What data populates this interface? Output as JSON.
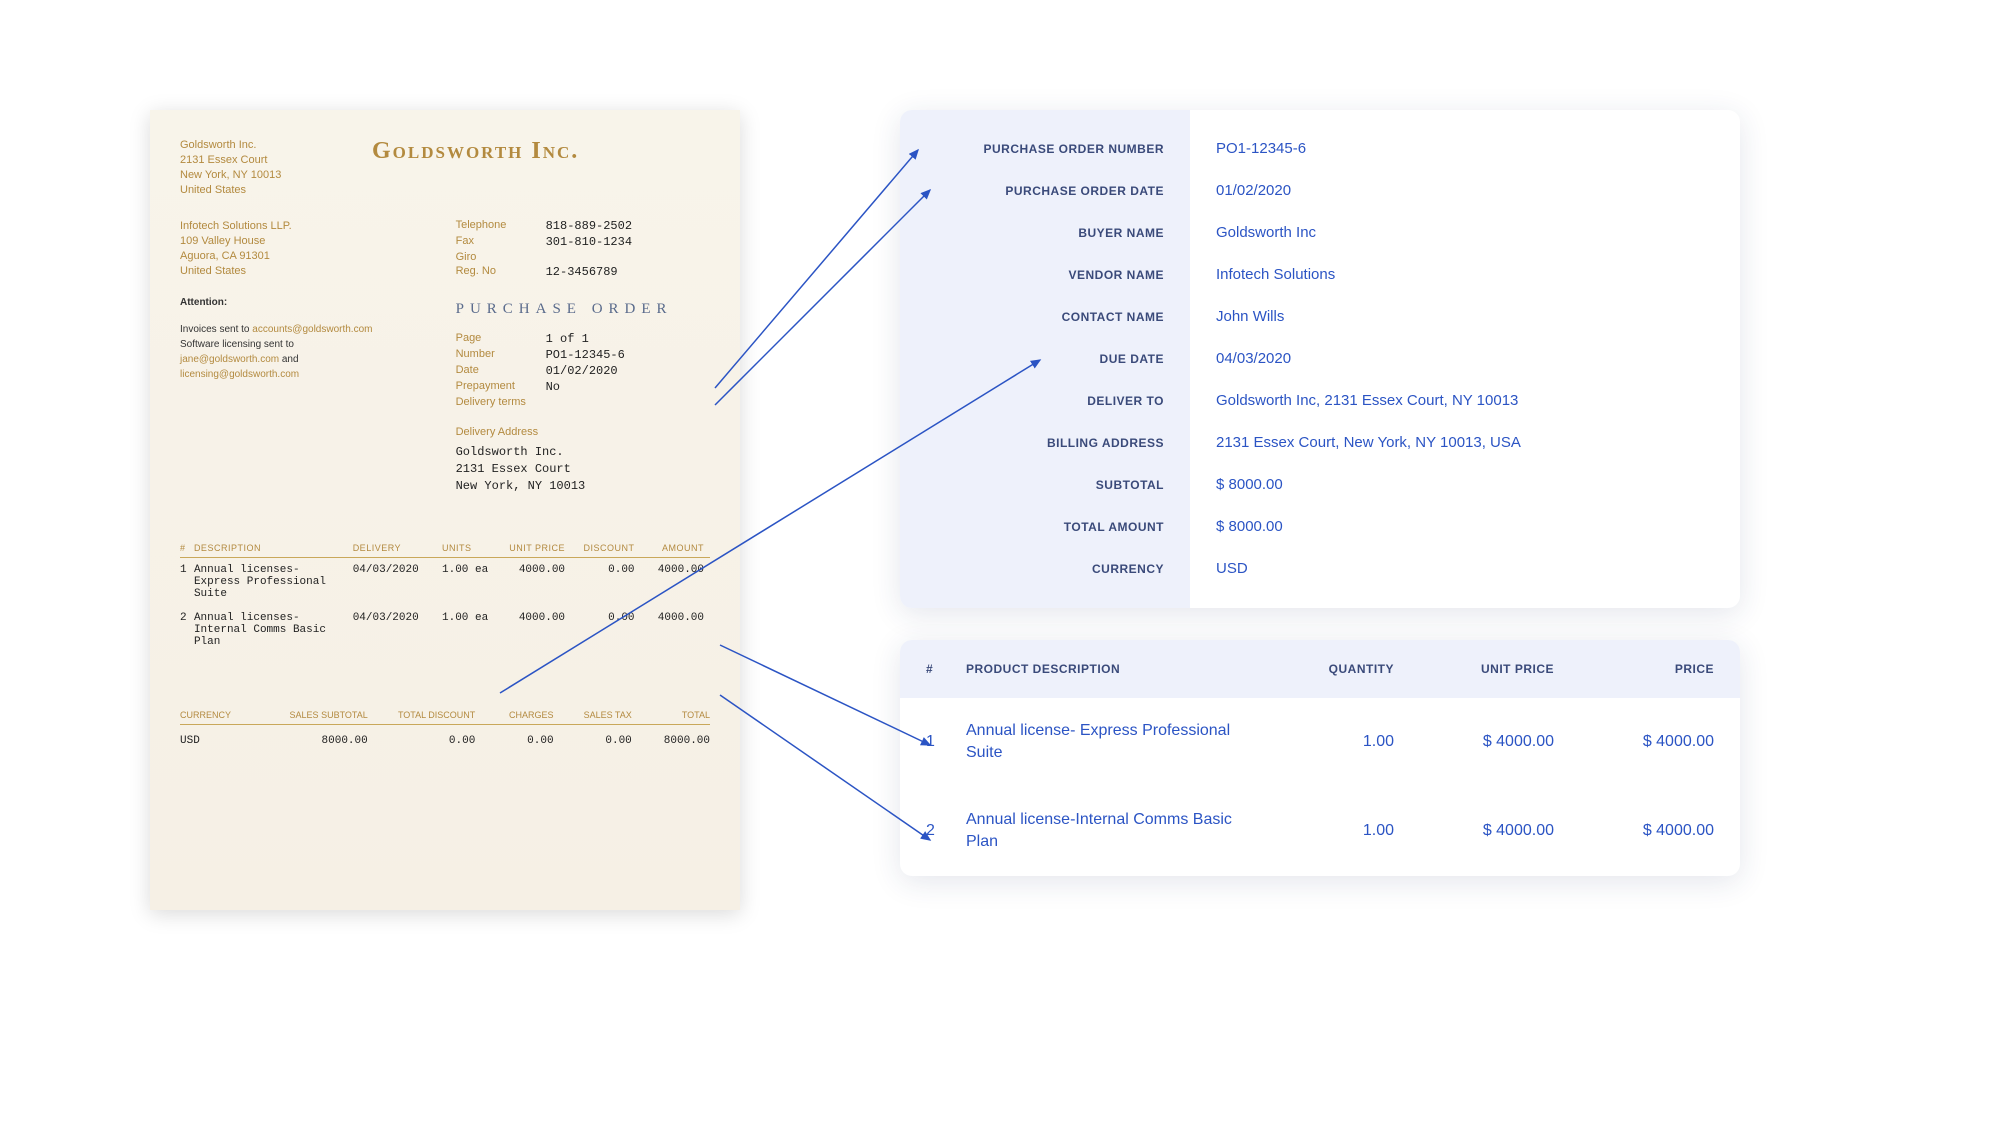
{
  "po": {
    "company_name": "Goldsworth Inc.",
    "from": {
      "name": "Goldsworth Inc.",
      "line1": "2131 Essex Court",
      "line2": "New York, NY 10013",
      "line3": "United States"
    },
    "to": {
      "name": "Infotech Solutions LLP.",
      "line1": "109 Valley House",
      "line2": "Aguora, CA 91301",
      "line3": "United States"
    },
    "contact": {
      "telephone_label": "Telephone",
      "telephone": "818-889-2502",
      "fax_label": "Fax",
      "fax": "301-810-1234",
      "giro_label": "Giro",
      "giro": "",
      "regno_label": "Reg. No",
      "regno": "12-3456789"
    },
    "doc_title": "PURCHASE ORDER",
    "fields": {
      "page_label": "Page",
      "page": "1 of 1",
      "number_label": "Number",
      "number": "PO1-12345-6",
      "date_label": "Date",
      "date": "01/02/2020",
      "prepayment_label": "Prepayment",
      "prepayment": "No",
      "delivery_terms_label": "Delivery terms",
      "delivery_terms": ""
    },
    "attention_label": "Attention:",
    "invoice_note": {
      "line1a": "Invoices sent to ",
      "email1": "accounts@goldsworth.com",
      "line2a": "Software licensing sent to",
      "email2": "jane@goldsworth.com",
      "and": " and",
      "email3": "licensing@goldsworth.com"
    },
    "delivery_title": "Delivery Address",
    "delivery": {
      "line1": "Goldsworth Inc.",
      "line2": "2131 Essex Court",
      "line3": "New York, NY 10013"
    },
    "items_head": {
      "n": "#",
      "desc": "DESCRIPTION",
      "del": "DELIVERY",
      "units": "UNITS",
      "uprice": "UNIT PRICE",
      "disc": "DISCOUNT",
      "amt": "AMOUNT"
    },
    "items": [
      {
        "n": "1",
        "desc": "Annual licenses- Express Professional Suite",
        "del": "04/03/2020",
        "units": "1.00 ea",
        "uprice": "4000.00",
        "disc": "0.00",
        "amt": "4000.00"
      },
      {
        "n": "2",
        "desc": "Annual licenses- Internal Comms Basic Plan",
        "del": "04/03/2020",
        "units": "1.00 ea",
        "uprice": "4000.00",
        "disc": "0.00",
        "amt": "4000.00"
      }
    ],
    "totals_head": {
      "cur": "CURRENCY",
      "sub": "SALES SUBTOTAL",
      "disc": "TOTAL DISCOUNT",
      "chg": "CHARGES",
      "tax": "SALES TAX",
      "tot": "TOTAL"
    },
    "totals": {
      "cur": "USD",
      "sub": "8000.00",
      "disc": "0.00",
      "chg": "0.00",
      "tax": "0.00",
      "tot": "8000.00"
    }
  },
  "extracted": {
    "labels": {
      "po_number": "PURCHASE ORDER NUMBER",
      "po_date": "PURCHASE ORDER DATE",
      "buyer": "BUYER NAME",
      "vendor": "VENDOR NAME",
      "contact": "CONTACT NAME",
      "due": "DUE DATE",
      "deliver_to": "DELIVER TO",
      "billing": "BILLING ADDRESS",
      "subtotal": "SUBTOTAL",
      "total": "TOTAL AMOUNT",
      "currency": "CURRENCY"
    },
    "values": {
      "po_number": "PO1-12345-6",
      "po_date": "01/02/2020",
      "buyer": "Goldsworth Inc",
      "vendor": "Infotech Solutions",
      "contact": "John Wills",
      "due": "04/03/2020",
      "deliver_to": "Goldsworth Inc, 2131 Essex Court, NY 10013",
      "billing": "2131 Essex Court, New York, NY 10013, USA",
      "subtotal": "$ 8000.00",
      "total": "$ 8000.00",
      "currency": "USD"
    },
    "items_head": {
      "n": "#",
      "desc": "PRODUCT DESCRIPTION",
      "qty": "QUANTITY",
      "uprice": "UNIT PRICE",
      "price": "PRICE"
    },
    "items": [
      {
        "n": "1",
        "desc": "Annual license- Express Professional Suite",
        "qty": "1.00",
        "uprice": "$ 4000.00",
        "price": "$ 4000.00"
      },
      {
        "n": "2",
        "desc": "Annual license-Internal Comms Basic Plan",
        "qty": "1.00",
        "uprice": "$ 4000.00",
        "price": "$ 4000.00"
      }
    ]
  }
}
